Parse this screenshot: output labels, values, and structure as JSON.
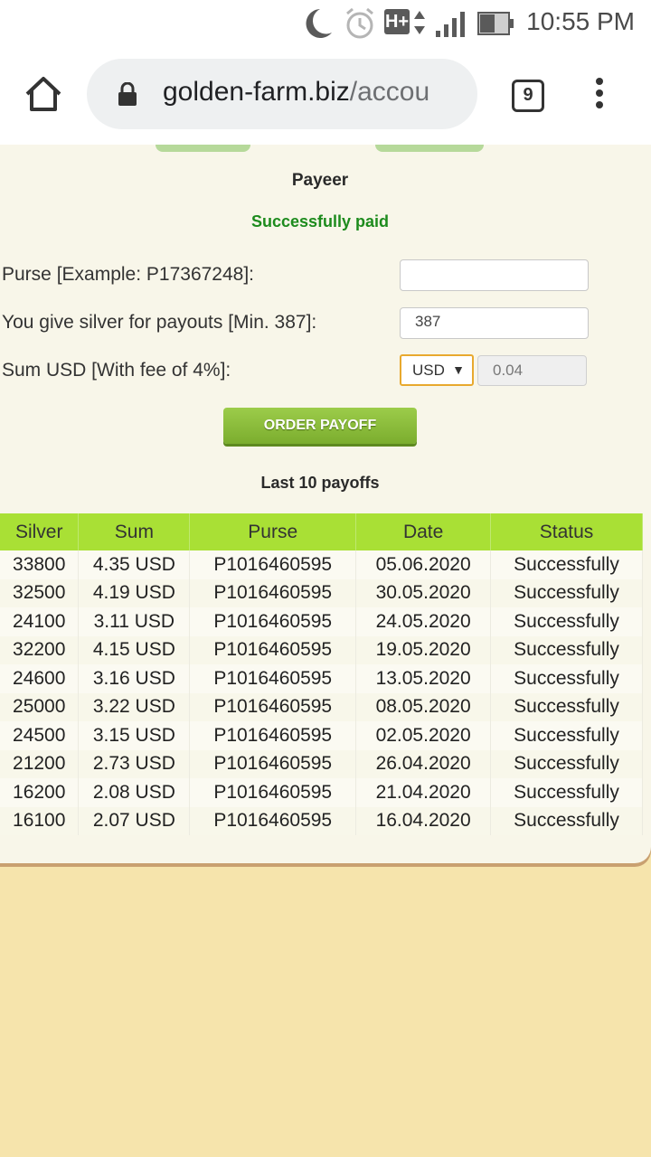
{
  "status_bar": {
    "time": "10:55 PM",
    "network_label": "H+",
    "icons": [
      "moon-icon",
      "alarm-icon",
      "network-type-icon",
      "signal-icon",
      "battery-icon"
    ]
  },
  "browser": {
    "url_domain": "golden-farm.biz",
    "url_path": "/accou",
    "tab_count": "9",
    "icons": [
      "home-icon",
      "lock-icon",
      "tabs-icon",
      "more-menu-icon"
    ]
  },
  "payout_form": {
    "method": "Payeer",
    "message": "Successfully paid",
    "purse_label": "Purse [Example: P17367248]:",
    "purse_value": "",
    "silver_label": "You give silver for payouts [Min. 387]:",
    "silver_value": "387",
    "sum_label": "Sum USD [With fee of 4%]:",
    "currency_selected": "USD",
    "sum_value": "0.04",
    "submit_label": "ORDER PAYOFF"
  },
  "payoffs": {
    "title": "Last 10 payoffs",
    "columns": [
      "Silver",
      "Sum",
      "Purse",
      "Date",
      "Status"
    ],
    "rows": [
      [
        "33800",
        "4.35 USD",
        "P1016460595",
        "05.06.2020",
        "Successfully"
      ],
      [
        "32500",
        "4.19 USD",
        "P1016460595",
        "30.05.2020",
        "Successfully"
      ],
      [
        "24100",
        "3.11 USD",
        "P1016460595",
        "24.05.2020",
        "Successfully"
      ],
      [
        "32200",
        "4.15 USD",
        "P1016460595",
        "19.05.2020",
        "Successfully"
      ],
      [
        "24600",
        "3.16 USD",
        "P1016460595",
        "13.05.2020",
        "Successfully"
      ],
      [
        "25000",
        "3.22 USD",
        "P1016460595",
        "08.05.2020",
        "Successfully"
      ],
      [
        "24500",
        "3.15 USD",
        "P1016460595",
        "02.05.2020",
        "Successfully"
      ],
      [
        "21200",
        "2.73 USD",
        "P1016460595",
        "26.04.2020",
        "Successfully"
      ],
      [
        "16200",
        "2.08 USD",
        "P1016460595",
        "21.04.2020",
        "Successfully"
      ],
      [
        "16100",
        "2.07 USD",
        "P1016460595",
        "16.04.2020",
        "Successfully"
      ]
    ]
  },
  "colors": {
    "table_header": "#a9e035",
    "success_text": "#1d8b1d",
    "button": "#8cbe3c",
    "page_background": "#f6e4ac",
    "card_background": "#f8f6e9"
  }
}
